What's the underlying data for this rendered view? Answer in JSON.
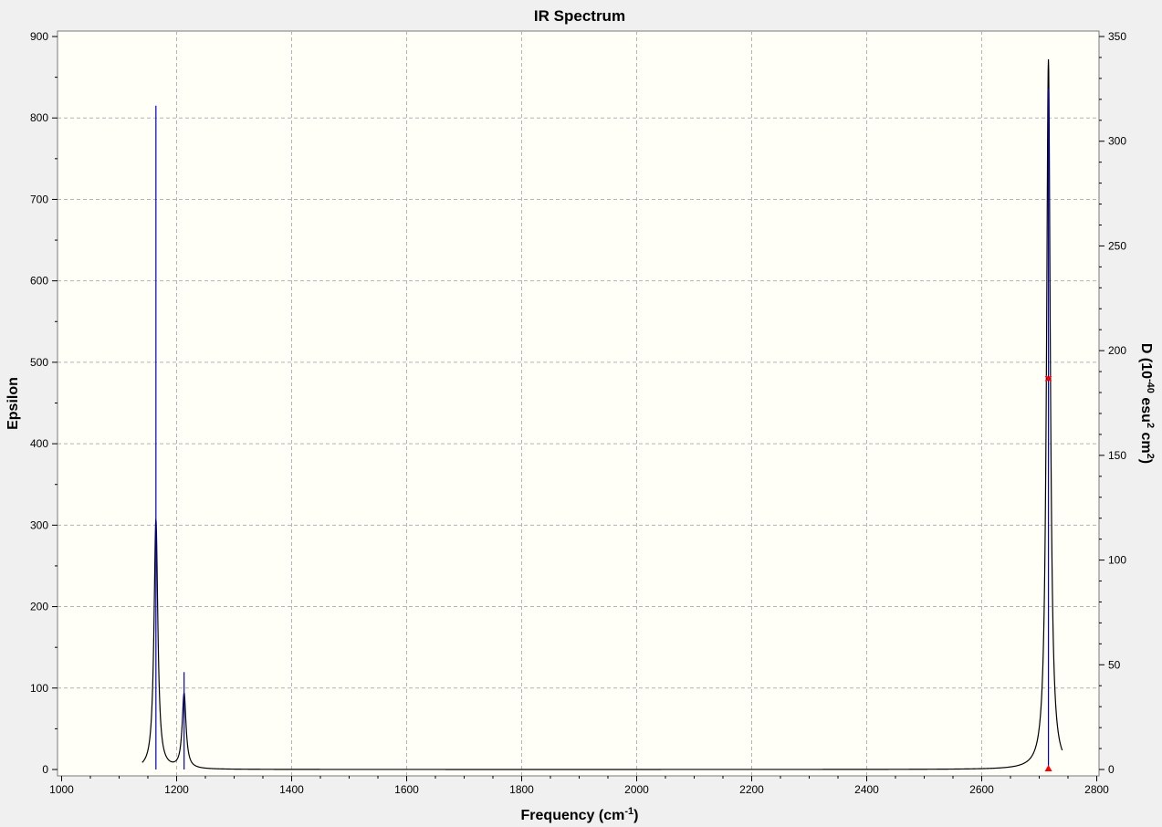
{
  "chart_data": {
    "type": "line",
    "title": "IR Spectrum",
    "xlabel": {
      "main": "Frequency (cm",
      "sup": "-1",
      "end": ")"
    },
    "ylabel_left": "Epsilon",
    "ylabel_right": {
      "p1": "D (10",
      "sup1": "-40",
      "p2": " esu",
      "sup2": "2",
      "p3": " cm",
      "sup3": "2",
      "p4": ")"
    },
    "xlim": [
      1000,
      2800
    ],
    "ylim_left": [
      0,
      900
    ],
    "ylim_right": [
      0,
      350
    ],
    "x_ticks": [
      1000,
      1200,
      1400,
      1600,
      1800,
      2000,
      2200,
      2400,
      2600,
      2800
    ],
    "y_left_ticks": [
      0,
      100,
      200,
      300,
      400,
      500,
      600,
      700,
      800,
      900
    ],
    "y_right_ticks": [
      0,
      50,
      100,
      150,
      200,
      250,
      300,
      350
    ],
    "grid": true,
    "colors": {
      "plot_bg": "#fffff8",
      "grid": "#b4b4b4",
      "spectrum": "#000000",
      "stick": "#0000cc",
      "marker": "#ff0000"
    },
    "series": [
      {
        "kind": "spectrum",
        "axis": "left",
        "x_range": [
          1140,
          2740
        ],
        "peaks": [
          {
            "x": 1164,
            "epsilon": 307,
            "hwhm": 4.0
          },
          {
            "x": 1213,
            "epsilon": 92,
            "hwhm": 4.0
          },
          {
            "x": 2716,
            "epsilon": 872,
            "hwhm": 4.0
          }
        ]
      },
      {
        "kind": "sticks",
        "axis": "right",
        "points": [
          {
            "x": 1164,
            "d": 317
          },
          {
            "x": 1213,
            "d": 46.5
          },
          {
            "x": 2716,
            "d": 325
          }
        ]
      }
    ],
    "markers": [
      {
        "x": 2716,
        "epsilon": 480,
        "shape": "x"
      },
      {
        "x": 2716,
        "epsilon": 0,
        "shape": "triangle"
      }
    ]
  }
}
